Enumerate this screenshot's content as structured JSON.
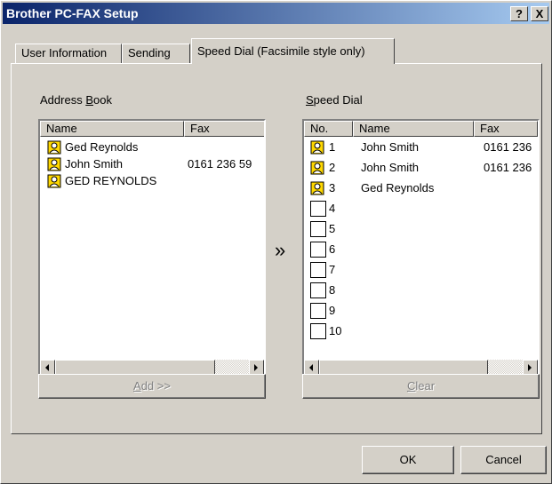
{
  "window": {
    "title": "Brother PC-FAX Setup",
    "help_label": "?",
    "close_label": "X"
  },
  "tabs": [
    {
      "label": "User Information"
    },
    {
      "label": "Sending"
    },
    {
      "label": "Speed Dial (Facsimile style only)"
    }
  ],
  "address_book": {
    "label_prefix": "Address ",
    "label_accel": "B",
    "label_suffix": "ook",
    "columns": [
      "Name",
      "Fax"
    ],
    "entries": [
      {
        "name": "Ged Reynolds",
        "fax": ""
      },
      {
        "name": "John Smith",
        "fax": "0161 236 59"
      },
      {
        "name": "GED REYNOLDS",
        "fax": ""
      }
    ],
    "add_button_accel": "A",
    "add_button_rest": "dd >>"
  },
  "transfer_glyph": "»",
  "speed_dial": {
    "label_accel": "S",
    "label_rest": "peed Dial",
    "columns": [
      "No.",
      "Name",
      "Fax"
    ],
    "entries": [
      {
        "no": "1",
        "name": "John Smith",
        "fax": "0161 236",
        "filled": true
      },
      {
        "no": "2",
        "name": "John Smith",
        "fax": "0161 236",
        "filled": true
      },
      {
        "no": "3",
        "name": "Ged Reynolds",
        "fax": "",
        "filled": true
      },
      {
        "no": "4",
        "name": "",
        "fax": "",
        "filled": false
      },
      {
        "no": "5",
        "name": "",
        "fax": "",
        "filled": false
      },
      {
        "no": "6",
        "name": "",
        "fax": "",
        "filled": false
      },
      {
        "no": "7",
        "name": "",
        "fax": "",
        "filled": false
      },
      {
        "no": "8",
        "name": "",
        "fax": "",
        "filled": false
      },
      {
        "no": "9",
        "name": "",
        "fax": "",
        "filled": false
      },
      {
        "no": "10",
        "name": "",
        "fax": "",
        "filled": false
      }
    ],
    "clear_button_accel": "C",
    "clear_button_rest": "lear"
  },
  "buttons": {
    "ok": "OK",
    "cancel": "Cancel"
  },
  "icons": {
    "contact": "contact-card-icon",
    "empty": "empty-slot-icon"
  },
  "colors": {
    "face": "#d4d0c8",
    "title_start": "#0a246a",
    "title_end": "#a6caf0",
    "icon_yellow": "#ffd800"
  }
}
